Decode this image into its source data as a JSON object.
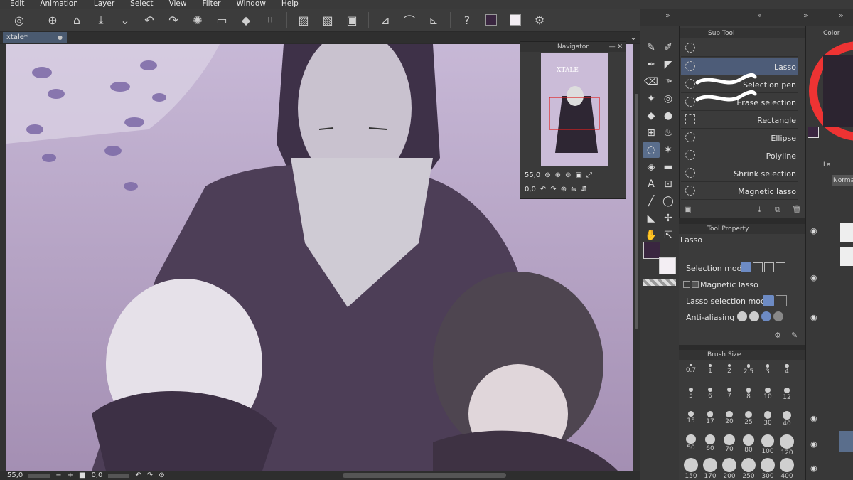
{
  "menu": [
    "Edit",
    "Animation",
    "Layer",
    "Select",
    "View",
    "Filter",
    "Window",
    "Help"
  ],
  "document": {
    "tab_title": "xtale*"
  },
  "navigator": {
    "title": "Navigator",
    "zoom": "55,0",
    "rotation": "0,0",
    "thumb_text": "XTALE"
  },
  "subtool": {
    "title": "Sub Tool",
    "items": [
      "Lasso",
      "Selection pen",
      "Erase selection",
      "Rectangle",
      "Ellipse",
      "Polyline",
      "Shrink selection",
      "Magnetic lasso"
    ]
  },
  "tool_property": {
    "title": "Tool Property",
    "tool_name": "Lasso",
    "rows": [
      "Selection mode",
      "Magnetic lasso",
      "Lasso selection mode",
      "Anti-aliasing"
    ]
  },
  "brush_size": {
    "title": "Brush Size",
    "sizes": [
      "0.7",
      "1",
      "2",
      "2.5",
      "3",
      "4",
      "5",
      "6",
      "7",
      "8",
      "10",
      "12",
      "15",
      "17",
      "20",
      "25",
      "30",
      "40",
      "50",
      "60",
      "70",
      "80",
      "100",
      "120",
      "150",
      "170",
      "200",
      "250",
      "300",
      "400"
    ]
  },
  "color_panel": {
    "title": "Color",
    "blend": "Normal",
    "layer_tab": "La"
  },
  "status": {
    "zoom": "55,0",
    "rotation": "0,0"
  },
  "colors": {
    "main": "#3a2640",
    "sub": "#f3eef3",
    "accent": "#5a6e8c"
  }
}
